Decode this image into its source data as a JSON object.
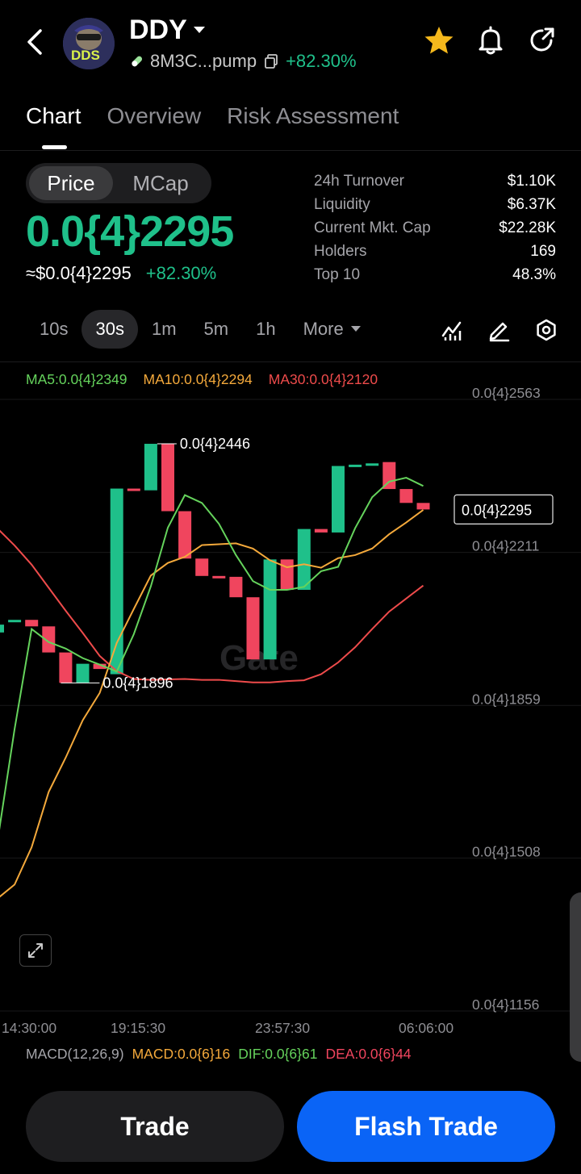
{
  "header": {
    "token_name": "DDY",
    "logo_text": "DDS",
    "address": "8M3C...pump",
    "change": "+82.30%"
  },
  "tabs": [
    {
      "label": "Chart",
      "active": true
    },
    {
      "label": "Overview",
      "active": false
    },
    {
      "label": "Risk Assessment",
      "active": false
    }
  ],
  "toggle": {
    "price": "Price",
    "mcap": "MCap"
  },
  "price": {
    "main": "0.0{4}2295",
    "usd": "≈$0.0{4}2295",
    "change": "+82.30%"
  },
  "stats": [
    {
      "label": "24h  Turnover",
      "value": "$1.10K"
    },
    {
      "label": "Liquidity",
      "value": "$6.37K"
    },
    {
      "label": "Current Mkt. Cap",
      "value": "$22.28K"
    },
    {
      "label": "Holders",
      "value": "169"
    },
    {
      "label": "Top 10",
      "value": "48.3%"
    }
  ],
  "intervals": [
    {
      "label": "10s",
      "active": false
    },
    {
      "label": "30s",
      "active": true
    },
    {
      "label": "1m",
      "active": false
    },
    {
      "label": "5m",
      "active": false
    },
    {
      "label": "1h",
      "active": false
    }
  ],
  "more_label": "More",
  "ma_legend": {
    "ma5": "MA5:0.0{4}2349",
    "ma10": "MA10:0.0{4}2294",
    "ma30": "MA30:0.0{4}2120"
  },
  "watermark": "Gate",
  "chart_data": {
    "type": "candlestick",
    "y_tick_labels": [
      "0.0{4}2563",
      "0.0{4}2211",
      "0.0{4}1859",
      "0.0{4}1508",
      "0.0{4}1156"
    ],
    "y_ticks": [
      2.563e-05,
      2.211e-05,
      1.859e-05,
      1.508e-05,
      1.156e-05
    ],
    "x_tick_labels": [
      "14:30:00",
      "19:15:30",
      "23:57:30",
      "06:06:00"
    ],
    "high_label": "0.0{4}2446",
    "low_label": "0.0{4}1896",
    "current_label": "0.0{4}2295",
    "high": 2.446e-05,
    "low": 1.896e-05,
    "current": 2.295e-05,
    "colors": {
      "up": "#1fc08a",
      "down": "#f0455e",
      "ma5": "#65d35c",
      "ma10": "#f4a93b",
      "ma30": "#ee4b4b"
    },
    "candles": [
      {
        "o": 2.012e-05,
        "c": 2.03e-05,
        "h": 2.03e-05,
        "l": 2.012e-05
      },
      {
        "o": 2.038e-05,
        "c": 2.041e-05,
        "h": 2.041e-05,
        "l": 2.038e-05
      },
      {
        "o": 2.041e-05,
        "c": 2.026e-05,
        "h": 2.041e-05,
        "l": 2.026e-05
      },
      {
        "o": 2.026e-05,
        "c": 1.966e-05,
        "h": 2.026e-05,
        "l": 1.966e-05
      },
      {
        "o": 1.966e-05,
        "c": 1.896e-05,
        "h": 1.966e-05,
        "l": 1.896e-05
      },
      {
        "o": 1.896e-05,
        "c": 1.94e-05,
        "h": 1.94e-05,
        "l": 1.896e-05
      },
      {
        "o": 1.94e-05,
        "c": 1.928e-05,
        "h": 1.94e-05,
        "l": 1.928e-05
      },
      {
        "o": 1.916e-05,
        "c": 2.343e-05,
        "h": 2.343e-05,
        "l": 1.916e-05
      },
      {
        "o": 2.343e-05,
        "c": 2.339e-05,
        "h": 2.343e-05,
        "l": 2.339e-05
      },
      {
        "o": 2.339e-05,
        "c": 2.446e-05,
        "h": 2.446e-05,
        "l": 2.339e-05
      },
      {
        "o": 2.446e-05,
        "c": 2.291e-05,
        "h": 2.446e-05,
        "l": 2.291e-05
      },
      {
        "o": 2.291e-05,
        "c": 2.182e-05,
        "h": 2.291e-05,
        "l": 2.182e-05
      },
      {
        "o": 2.182e-05,
        "c": 2.142e-05,
        "h": 2.182e-05,
        "l": 2.142e-05
      },
      {
        "o": 2.142e-05,
        "c": 2.14e-05,
        "h": 2.142e-05,
        "l": 2.14e-05
      },
      {
        "o": 2.14e-05,
        "c": 2.093e-05,
        "h": 2.14e-05,
        "l": 2.093e-05
      },
      {
        "o": 2.093e-05,
        "c": 1.95e-05,
        "h": 2.093e-05,
        "l": 1.95e-05
      },
      {
        "o": 1.95e-05,
        "c": 2.18e-05,
        "h": 2.18e-05,
        "l": 1.95e-05
      },
      {
        "o": 2.18e-05,
        "c": 2.11e-05,
        "h": 2.18e-05,
        "l": 2.11e-05
      },
      {
        "o": 2.11e-05,
        "c": 2.25e-05,
        "h": 2.25e-05,
        "l": 2.11e-05
      },
      {
        "o": 2.25e-05,
        "c": 2.242e-05,
        "h": 2.25e-05,
        "l": 2.242e-05
      },
      {
        "o": 2.242e-05,
        "c": 2.395e-05,
        "h": 2.395e-05,
        "l": 2.242e-05
      },
      {
        "o": 2.395e-05,
        "c": 2.398e-05,
        "h": 2.398e-05,
        "l": 2.395e-05
      },
      {
        "o": 2.398e-05,
        "c": 2.401e-05,
        "h": 2.401e-05,
        "l": 2.398e-05
      },
      {
        "o": 2.404e-05,
        "c": 2.342e-05,
        "h": 2.404e-05,
        "l": 2.342e-05
      },
      {
        "o": 2.342e-05,
        "c": 2.31e-05,
        "h": 2.342e-05,
        "l": 2.31e-05
      },
      {
        "o": 2.31e-05,
        "c": 2.295e-05,
        "h": 2.31e-05,
        "l": 2.295e-05
      }
    ],
    "ma5": [
      1.533e-05,
      1.79e-05,
      2.02e-05,
      1.99e-05,
      1.975e-05,
      1.953e-05,
      1.938e-05,
      1.922e-05,
      2.008e-05,
      2.118e-05,
      2.253e-05,
      2.328e-05,
      2.31e-05,
      2.262e-05,
      2.19e-05,
      2.13e-05,
      2.11e-05,
      2.11e-05,
      2.117e-05,
      2.153e-05,
      2.163e-05,
      2.252e-05,
      2.323e-05,
      2.359e-05,
      2.368e-05,
      2.349e-05
    ],
    "ma10": [
      1.4e-05,
      1.432e-05,
      1.518e-05,
      1.645e-05,
      1.724e-05,
      1.81e-05,
      1.873e-05,
      1.988e-05,
      2.066e-05,
      2.143e-05,
      2.172e-05,
      2.186e-05,
      2.213e-05,
      2.215e-05,
      2.217e-05,
      2.205e-05,
      2.178e-05,
      2.162e-05,
      2.169e-05,
      2.161e-05,
      2.183e-05,
      2.19e-05,
      2.205e-05,
      2.238e-05,
      2.265e-05,
      2.294e-05
    ],
    "ma30": [
      2.251e-05,
      2.212e-05,
      2.168e-05,
      2.115e-05,
      2.062e-05,
      2.011e-05,
      1.958e-05,
      1.923e-05,
      1.905e-05,
      1.903e-05,
      1.904e-05,
      1.905e-05,
      1.903e-05,
      1.903e-05,
      1.9e-05,
      1.897e-05,
      1.897e-05,
      1.9e-05,
      1.902e-05,
      1.916e-05,
      1.943e-05,
      1.978e-05,
      2.02e-05,
      2.06e-05,
      2.09e-05,
      2.12e-05
    ]
  },
  "macd": {
    "label": "MACD(12,26,9)",
    "macd": "MACD:0.0{6}16",
    "dif": "DIF:0.0{6}61",
    "dea": "DEA:0.0{6}44"
  },
  "buttons": {
    "trade": "Trade",
    "flash_trade": "Flash Trade"
  }
}
